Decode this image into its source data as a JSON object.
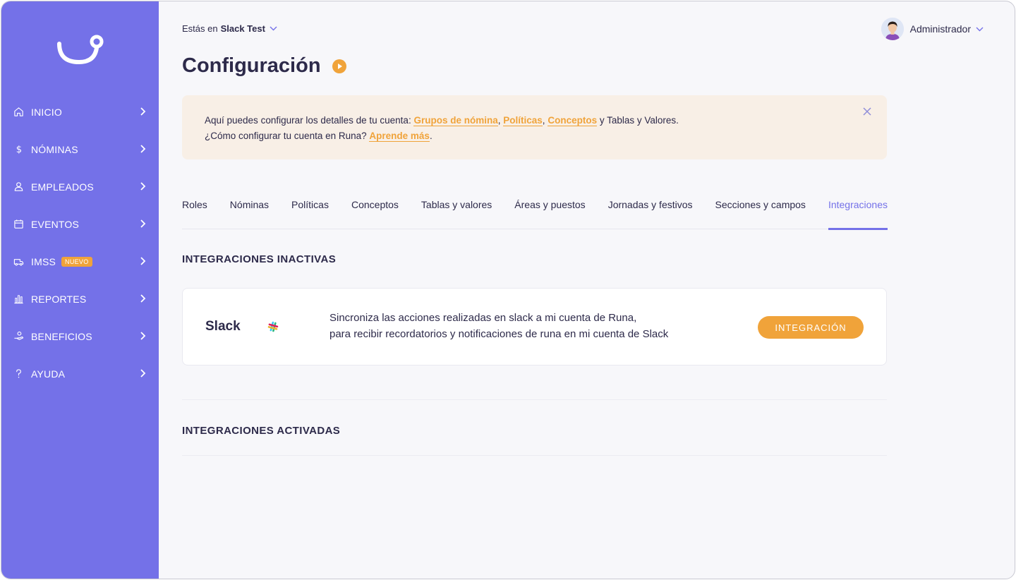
{
  "colors": {
    "sidebar": "#7471e8",
    "accent": "#f0a33a",
    "tab_active": "#7471e8",
    "text": "#2d2a4a",
    "banner_bg": "#f8efe6"
  },
  "sidebar": {
    "items": [
      {
        "label": "INICIO",
        "icon": "home-icon"
      },
      {
        "label": "NÓMINAS",
        "icon": "dollar-icon"
      },
      {
        "label": "EMPLEADOS",
        "icon": "user-icon"
      },
      {
        "label": "EVENTOS",
        "icon": "calendar-icon"
      },
      {
        "label": "IMSS",
        "icon": "ambulance-icon",
        "badge": "NUEVO"
      },
      {
        "label": "REPORTES",
        "icon": "bar-chart-icon"
      },
      {
        "label": "BENEFICIOS",
        "icon": "hand-coin-icon"
      },
      {
        "label": "AYUDA",
        "icon": "question-icon"
      }
    ]
  },
  "header": {
    "context_prefix": "Estás en",
    "context_account": "Slack Test",
    "user_name": "Administrador"
  },
  "page": {
    "title": "Configuración"
  },
  "banner": {
    "line1_prefix": "Aquí puedes configurar los detalles de tu cuenta:",
    "link1": "Grupos de nómina",
    "sep1": ",",
    "link2": "Políticas",
    "sep2": ",",
    "link3": "Conceptos",
    "line1_suffix": "y Tablas y Valores.",
    "line2_prefix": "¿Cómo configurar tu cuenta en Runa?",
    "link4": "Aprende más",
    "line2_suffix": "."
  },
  "tabs": [
    {
      "label": "Roles"
    },
    {
      "label": "Nóminas"
    },
    {
      "label": "Políticas"
    },
    {
      "label": "Conceptos"
    },
    {
      "label": "Tablas y valores"
    },
    {
      "label": "Áreas y puestos"
    },
    {
      "label": "Jornadas y festivos"
    },
    {
      "label": "Secciones y campos"
    },
    {
      "label": "Integraciones",
      "active": true
    }
  ],
  "inactive": {
    "title": "INTEGRACIONES INACTIVAS",
    "card": {
      "name": "Slack",
      "icon": "slack-icon",
      "desc_line1": "Sincroniza las acciones realizadas en slack a mi cuenta de Runa,",
      "desc_line2": "para recibir recordatorios y notificaciones de runa en mi cuenta de Slack",
      "button": "INTEGRACIÓN"
    }
  },
  "active": {
    "title": "INTEGRACIONES ACTIVADAS"
  }
}
